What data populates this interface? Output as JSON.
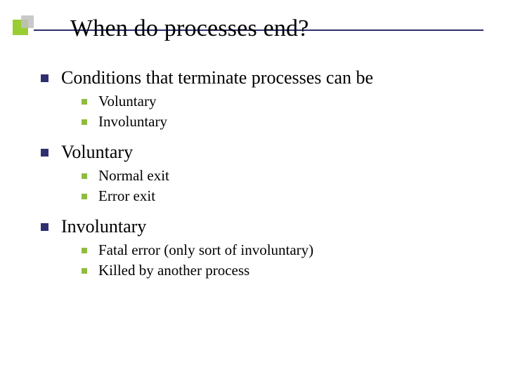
{
  "title": "When do processes end?",
  "items": [
    {
      "label": "Conditions that terminate processes can be",
      "sub": [
        "Voluntary",
        "Involuntary"
      ]
    },
    {
      "label": "Voluntary",
      "sub": [
        "Normal exit",
        "Error exit"
      ]
    },
    {
      "label": "Involuntary",
      "sub": [
        "Fatal error (only sort of involuntary)",
        "Killed by another process"
      ]
    }
  ]
}
